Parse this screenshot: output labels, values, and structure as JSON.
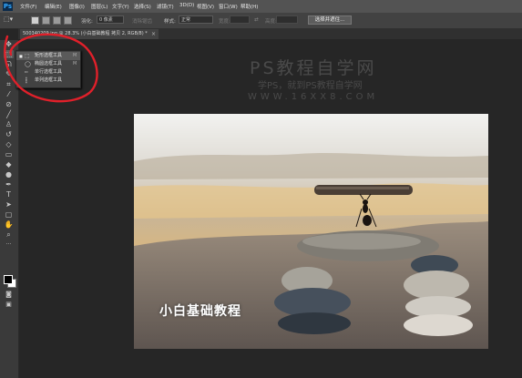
{
  "menubar": {
    "logo": "Ps",
    "items": [
      "文件(F)",
      "编辑(E)",
      "图像(I)",
      "图层(L)",
      "文字(Y)",
      "选择(S)",
      "滤镜(T)",
      "3D(D)",
      "视图(V)",
      "窗口(W)",
      "帮助(H)"
    ]
  },
  "options": {
    "feather_label": "羽化:",
    "feather_value": "0 像素",
    "antialias_label": "消除锯齿",
    "style_label": "样式:",
    "style_value": "正常",
    "width_label": "宽度:",
    "height_label": "高度:",
    "select_mask_button": "选择并遮住..."
  },
  "document": {
    "tab_title": "500340209.jpg @ 28.3% (小白基础教程 拷贝 2, RGB/8) *",
    "close_glyph": "×"
  },
  "tool_flyout": {
    "items": [
      {
        "label": "矩形选框工具",
        "shortcut": "M"
      },
      {
        "label": "椭圆选框工具",
        "shortcut": "M"
      },
      {
        "label": "单行选框工具",
        "shortcut": ""
      },
      {
        "label": "单列选框工具",
        "shortcut": ""
      }
    ]
  },
  "watermark": {
    "title": "PS教程自学网",
    "subtitle": "学PS，就到PS教程自学网",
    "url": "WWW.16XX8.COM"
  },
  "photo": {
    "caption": "小白基础教程"
  },
  "colors": {
    "menubar_bg": "#535353",
    "options_bg": "#424242",
    "canvas_bg": "#262626",
    "annotation_red": "#e0202a",
    "ps_blue": "#31a8ff"
  }
}
